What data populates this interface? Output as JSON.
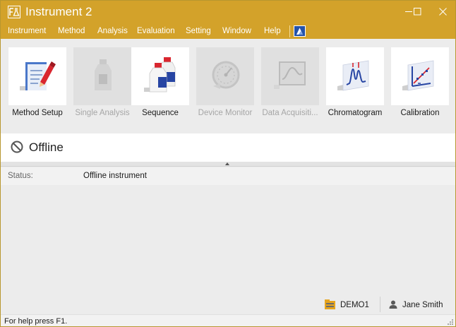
{
  "window": {
    "title": "Instrument 2",
    "accent_color": "#d3a22a",
    "controls": [
      "minimize-icon",
      "maximize-icon",
      "close-icon"
    ]
  },
  "menu": {
    "items": [
      "Instrument",
      "Method",
      "Analysis",
      "Evaluation",
      "Setting",
      "Window",
      "Help"
    ],
    "help_icon": "app-help-icon"
  },
  "toolbar": {
    "tools": [
      {
        "label": "Method Setup",
        "icon": "method-setup-icon",
        "enabled": true
      },
      {
        "label": "Single Analysis",
        "icon": "single-analysis-icon",
        "enabled": false
      },
      {
        "label": "Sequence",
        "icon": "sequence-icon",
        "enabled": true
      },
      {
        "label": "Device Monitor",
        "icon": "device-monitor-icon",
        "enabled": false
      },
      {
        "label": "Data Acquisiti...",
        "icon": "data-acquisition-icon",
        "enabled": false
      },
      {
        "label": "Chromatogram",
        "icon": "chromatogram-icon",
        "enabled": true
      },
      {
        "label": "Calibration",
        "icon": "calibration-icon",
        "enabled": true
      }
    ]
  },
  "state": {
    "text": "Offline",
    "icon": "offline-icon"
  },
  "status": {
    "label": "Status:",
    "value": "Offline instrument"
  },
  "footer": {
    "database": "DEMO1",
    "user": "Jane Smith"
  },
  "statusbar": {
    "help_text": "For help press F1."
  }
}
